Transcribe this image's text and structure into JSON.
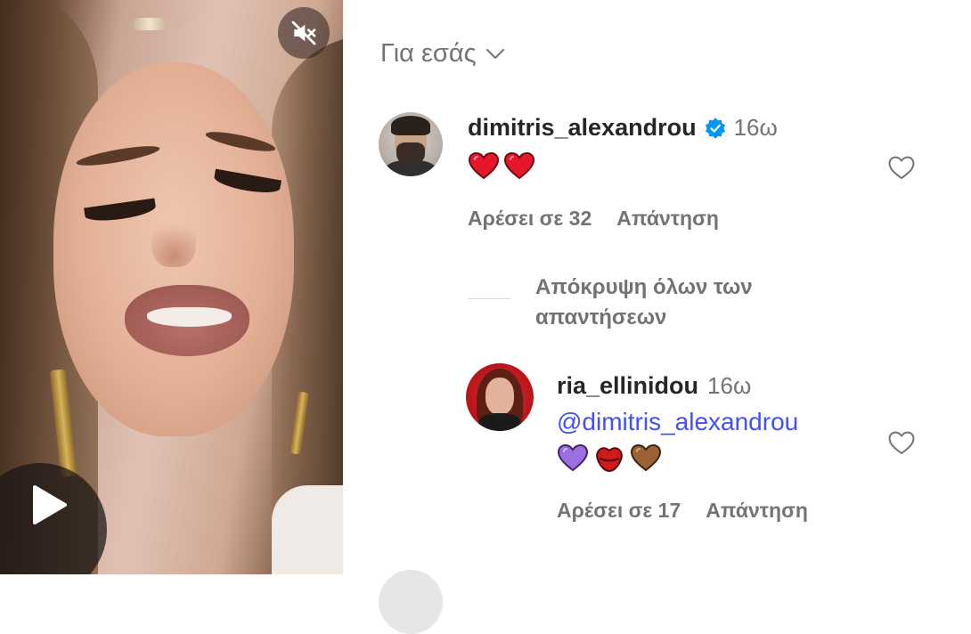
{
  "video": {
    "mute_icon": "speaker-muted-icon",
    "play_icon": "play-icon"
  },
  "comments_panel": {
    "filter_label": "Για εσάς",
    "filter_icon": "chevron-down-icon",
    "comments": [
      {
        "username": "dimitris_alexandrou",
        "verified": true,
        "time": "16ω",
        "text_emojis": "❤️❤️",
        "likes_label": "Αρέσει σε 32",
        "reply_label": "Απάντηση"
      }
    ],
    "hide_replies_label": "Απόκρυψη όλων των απαντήσεων",
    "replies": [
      {
        "username": "ria_ellinidou",
        "time": "16ω",
        "mention": "@dimitris_alexandrou",
        "text_emojis": "💜💋🤎",
        "likes_label": "Αρέσει σε 17",
        "reply_label": "Απάντηση"
      }
    ]
  },
  "colors": {
    "text_primary": "#262626",
    "text_secondary": "#737373",
    "mention": "#4150f7",
    "verified": "#0095f6"
  }
}
